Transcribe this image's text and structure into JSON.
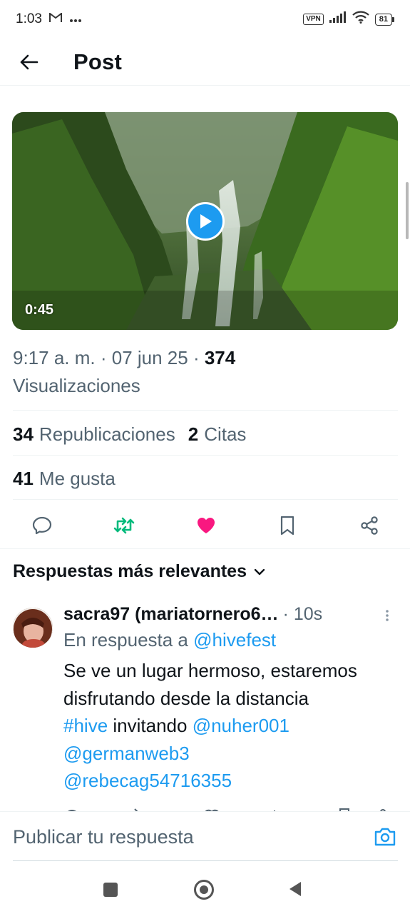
{
  "status_bar": {
    "time": "1:03",
    "vpn": "VPN",
    "battery": "81"
  },
  "header": {
    "title": "Post"
  },
  "video": {
    "duration": "0:45"
  },
  "meta": {
    "time": "9:17 a. m.",
    "sep1": " · ",
    "date": "07 jun 25",
    "sep2": " · ",
    "views_count": "374",
    "views_label": "Visualizaciones"
  },
  "stats": {
    "reposts_count": "34",
    "reposts_label": "Republicaciones",
    "quotes_count": "2",
    "quotes_label": "Citas",
    "likes_count": "41",
    "likes_label": "Me gusta"
  },
  "colors": {
    "accent": "#1d9bf0",
    "repost_green": "#00ba7c",
    "like_pink": "#f91880"
  },
  "replies": {
    "sort_label": "Respuestas más relevantes",
    "items": [
      {
        "name": "sacra97 (mariatornero6…",
        "time": "· 10s",
        "reply_to_prefix": "En respuesta a ",
        "reply_to_handle": "@hivefest",
        "text_line1": "Se ve un lugar hermoso, estaremos",
        "text_line2": "disfrutando desde la distancia",
        "hashtag": "#hive",
        "text_mid": " invitando ",
        "mention1": "@nuher001",
        "mention2": "@germanweb3",
        "mention3": "@rebecag54716355"
      }
    ]
  },
  "compose": {
    "placeholder": "Publicar tu respuesta"
  }
}
